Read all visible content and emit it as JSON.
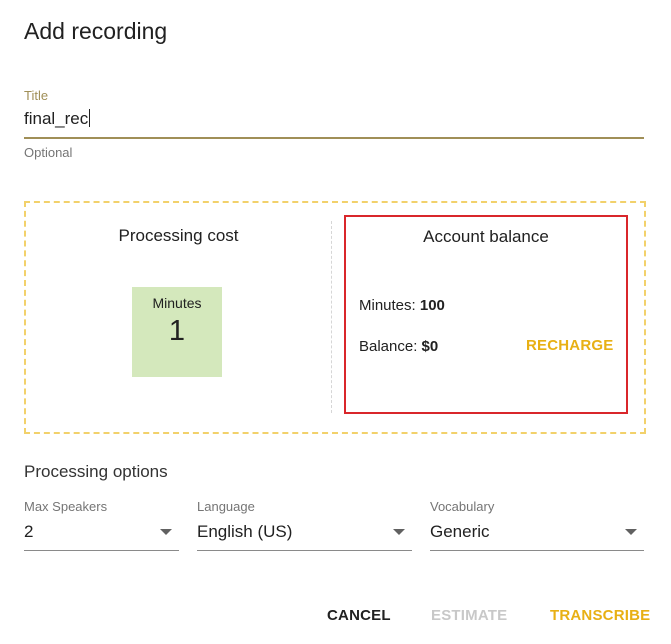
{
  "dialog": {
    "title": "Add recording"
  },
  "title_field": {
    "label": "Title",
    "value": "final_rec",
    "hint": "Optional"
  },
  "cost": {
    "heading": "Processing cost",
    "minutes_label": "Minutes",
    "minutes_value": "1"
  },
  "balance": {
    "heading": "Account balance",
    "minutes_label": "Minutes:",
    "minutes_value": "100",
    "balance_label": "Balance:",
    "balance_value": "$0",
    "recharge_label": "RECHARGE"
  },
  "options": {
    "heading": "Processing options",
    "max_speakers": {
      "label": "Max Speakers",
      "value": "2"
    },
    "language": {
      "label": "Language",
      "value": "English (US)"
    },
    "vocabulary": {
      "label": "Vocabulary",
      "value": "Generic"
    }
  },
  "actions": {
    "cancel": "CANCEL",
    "estimate": "ESTIMATE",
    "transcribe": "TRANSCRIBE"
  },
  "colors": {
    "accent": "#e8b014",
    "field_accent": "#a08f57",
    "highlight_border": "#d9262b",
    "minutes_tile": "#d4e8bc"
  }
}
